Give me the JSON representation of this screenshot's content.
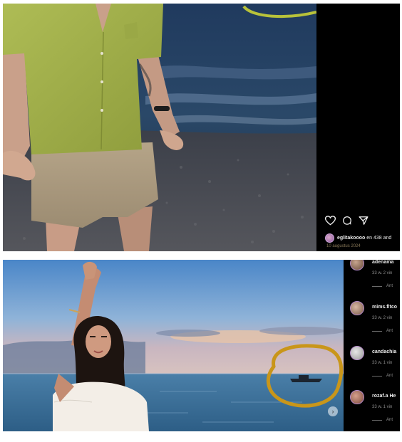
{
  "top_post": {
    "username": "eglitakoooo",
    "liked_by_text": "en 438 and",
    "date": "10 augustus 2024",
    "icons": [
      "heart-icon",
      "comment-icon",
      "share-icon"
    ]
  },
  "bottom_post": {
    "comments": [
      {
        "username": "adenama",
        "meta": "33 w.  2 vin",
        "replies": "Ant"
      },
      {
        "username": "mims.fitco",
        "meta": "33 w.  2 vin",
        "replies": "Ant"
      },
      {
        "username": "candachia",
        "meta": "33 w.  1 vin",
        "replies": "Ant"
      },
      {
        "username": "rozaf.a He",
        "meta": "33 w.  1 vin",
        "replies": "Ant"
      }
    ],
    "next_glyph": "›"
  },
  "highlight_colors": {
    "top_circle": "#b8c23a",
    "bottom_circle": "#c9961a"
  }
}
